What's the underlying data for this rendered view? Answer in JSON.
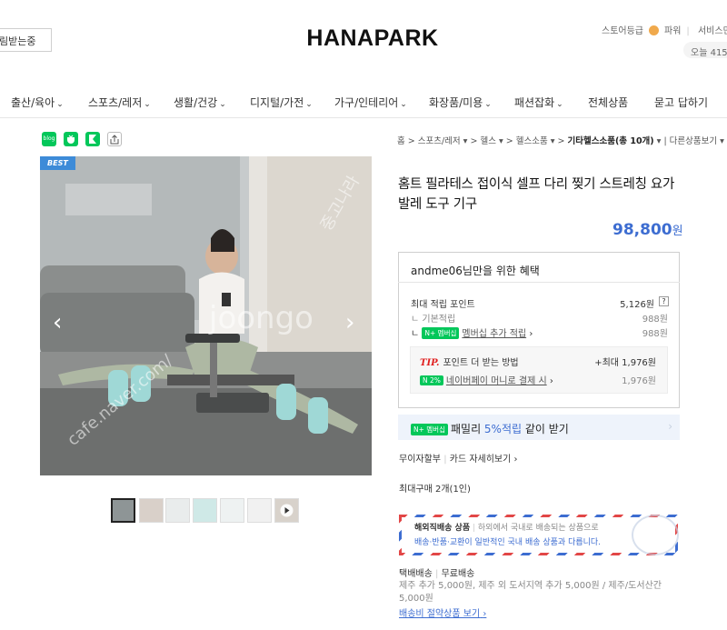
{
  "header": {
    "search_placeholder": "림받는중",
    "logo": "HANAPARK",
    "store_grade": "스토어등급",
    "power": "파워",
    "service": "서비스만",
    "today": "오늘 415"
  },
  "nav": {
    "items": [
      {
        "label": "출산/육아",
        "chev": "⌄"
      },
      {
        "label": "스포츠/레저",
        "chev": "⌄"
      },
      {
        "label": "생활/건강",
        "chev": "⌄"
      },
      {
        "label": "디지털/가전",
        "chev": "⌄"
      },
      {
        "label": "가구/인테리어",
        "chev": "⌄"
      },
      {
        "label": "화장품/미용",
        "chev": "⌄"
      },
      {
        "label": "패션잡화",
        "chev": "⌄"
      },
      {
        "label": "전체상품",
        "chev": ""
      },
      {
        "label": "묻고 답하기",
        "chev": ""
      }
    ]
  },
  "share": {
    "blog": "blog",
    "share_icons": [
      "blog-icon",
      "talk-icon",
      "bookmark-icon",
      "share-icon"
    ]
  },
  "breadcrumb": {
    "items": [
      "홈",
      "스포츠/레저",
      "헬스",
      "헬스소품"
    ],
    "current": "기타헬스소품(총 10개)",
    "more": "다른상품보기"
  },
  "gallery": {
    "badge": "BEST",
    "prev": "‹",
    "next": "›",
    "watermark1": "cafe.naver.com/",
    "watermark2": "joongo",
    "watermark3": "중고나라",
    "thumb_count": 7
  },
  "product": {
    "title": "홈트 필라테스 접이식 셀프 다리 찢기 스트레칭 요가 발레 도구 기구",
    "price": "98,800",
    "price_unit": "원"
  },
  "benefit": {
    "title": "andme06님만을 위한 혜택",
    "max_points_label": "최대 적립 포인트",
    "max_points_value": "5,126원",
    "basic_label": "기본적립",
    "basic_value": "988원",
    "membership_badge": "N+ 멤버십",
    "membership_label": "멤버십 추가 적립",
    "membership_value": "988원",
    "tip_label": "TIP.",
    "tip_text": "포인트 더 받는 방법",
    "tip_value": "+최대 1,976원",
    "naverpay_badge": "N 2%",
    "naverpay_label": "네이버페이 머니로 결제 시",
    "naverpay_value": "1,976원"
  },
  "family": {
    "badge": "N+ 멤버십",
    "text_pre": "패밀리 ",
    "text_highlight": "5%적립",
    "text_post": " 같이 받기",
    "chev": "›"
  },
  "payment": {
    "no_interest": "무이자할부",
    "card_info": "카드 자세히보기"
  },
  "purchase_limit": "최대구매 2개(1인)",
  "overseas": {
    "title": "해외직배송 상품",
    "desc": "하외에서 국내로 배송되는 상품으로",
    "desc2": "배송·반품·교환이 일반적인 국내 배송 상품과 다릅니다."
  },
  "shipping": {
    "method": "택배배송",
    "fee": "무료배송",
    "extra": "제주 추가 5,000원, 제주 외 도서지역 추가 5,000원 / 제주/도서산간 5,000원",
    "save_link": "배송비 절약상품 보기"
  }
}
